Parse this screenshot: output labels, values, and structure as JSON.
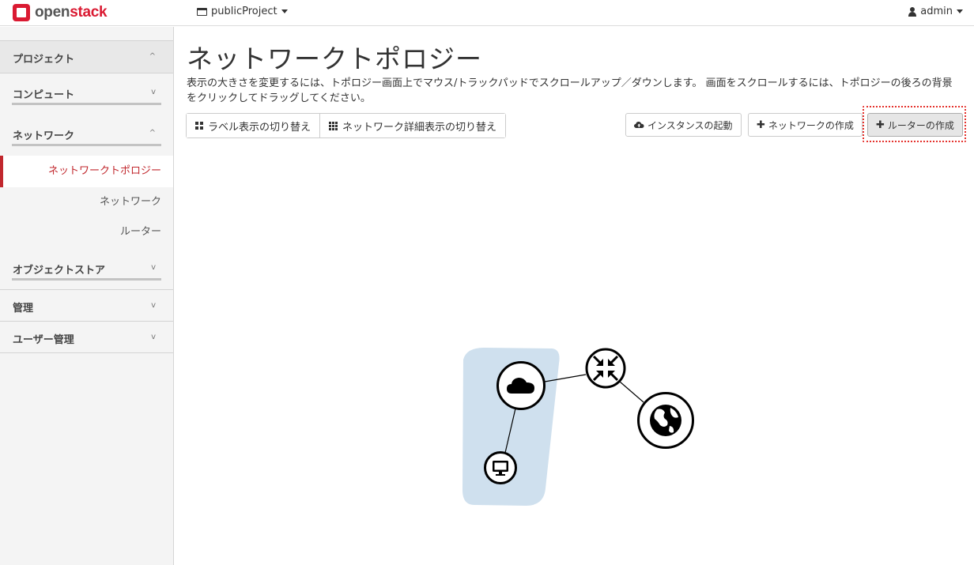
{
  "brand": {
    "part1": "open",
    "part2": "stack"
  },
  "project_selector": {
    "label": "publicProject"
  },
  "user_menu": {
    "label": "admin"
  },
  "sidebar": {
    "sections": [
      {
        "label": "プロジェクト",
        "chevron": "^"
      },
      {
        "label": "コンピュート",
        "chevron": "v"
      },
      {
        "label": "ネットワーク",
        "chevron": "^"
      },
      {
        "label": "オブジェクトストア",
        "chevron": "v"
      },
      {
        "label": "管理",
        "chevron": "v"
      },
      {
        "label": "ユーザー管理",
        "chevron": "v"
      }
    ],
    "items": [
      {
        "label": "ネットワークトポロジー",
        "active": true
      },
      {
        "label": "ネットワーク",
        "active": false
      },
      {
        "label": "ルーター",
        "active": false
      }
    ]
  },
  "main": {
    "title": "ネットワークトポロジー",
    "description": "表示の大きさを変更するには、トポロジー画面上でマウス/トラックパッドでスクロールアップ／ダウンします。 画面をスクロールするには、トポロジーの後ろの背景をクリックしてドラッグしてください。",
    "toggle_labels_button": "ラベル表示の切り替え",
    "toggle_network_details_button": "ネットワーク詳細表示の切り替え",
    "launch_instance_button": "インスタンスの起動",
    "create_network_button": "ネットワークの作成",
    "create_router_button": "ルーターの作成"
  },
  "topology": {
    "nodes": [
      {
        "type": "network",
        "icon": "cloud-icon"
      },
      {
        "type": "router",
        "icon": "router-arrows-icon"
      },
      {
        "type": "external-network",
        "icon": "globe-icon"
      },
      {
        "type": "instance",
        "icon": "monitor-icon"
      }
    ],
    "colors": {
      "network_area": "#cfe0ee",
      "node_stroke": "#000000",
      "highlight": "#e5322d",
      "accent": "#c1272d"
    }
  }
}
